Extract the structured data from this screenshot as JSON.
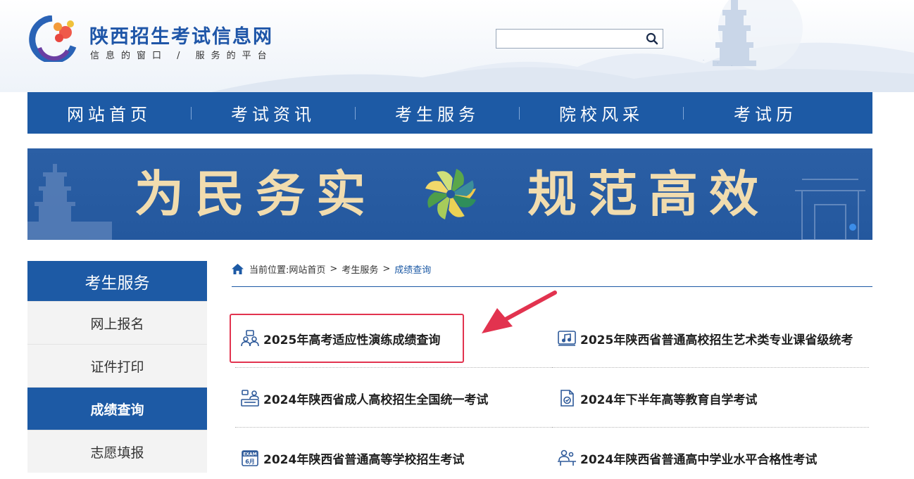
{
  "header": {
    "site_title": "陕西招生考试信息网",
    "site_slogan": "信息的窗口 / 服务的平台",
    "search": {
      "placeholder": "",
      "value": ""
    }
  },
  "nav": {
    "items": [
      "网站首页",
      "考试资讯",
      "考生服务",
      "院校风采",
      "考试历"
    ]
  },
  "banner": {
    "left_text": "为民务实",
    "right_text": "规范高效"
  },
  "sidebar": {
    "title": "考生服务",
    "items": [
      {
        "label": "网上报名",
        "active": false
      },
      {
        "label": "证件打印",
        "active": false
      },
      {
        "label": "成绩查询",
        "active": true
      },
      {
        "label": "志愿填报",
        "active": false
      }
    ]
  },
  "breadcrumb": {
    "prefix": "当前位置:",
    "items": [
      "网站首页",
      "考生服务",
      "成绩查询"
    ],
    "separator": ">"
  },
  "results": [
    {
      "label": "2025年高考适应性演练成绩查询",
      "icon": "students-icon",
      "highlighted": true
    },
    {
      "label": "2025年陕西省普通高校招生艺术类专业课省级统考",
      "icon": "music-book-icon",
      "highlighted": false
    },
    {
      "label": "2024年陕西省成人高校招生全国统一考试",
      "icon": "adult-exam-icon",
      "highlighted": false
    },
    {
      "label": "2024年下半年高等教育自学考试",
      "icon": "document-icon",
      "highlighted": false
    },
    {
      "label": "2024年陕西省普通高等学校招生考试",
      "icon": "exam-calendar-icon",
      "highlighted": false
    },
    {
      "label": "2024年陕西省普通高中学业水平合格性考试",
      "icon": "student-desk-icon",
      "highlighted": false
    }
  ],
  "exam_calendar_icon": {
    "badge": "EXAM",
    "month": "6月"
  },
  "colors": {
    "primary_blue": "#1d5aa5",
    "banner_gold": "#f1dcae",
    "highlight_red": "#e2334f"
  }
}
